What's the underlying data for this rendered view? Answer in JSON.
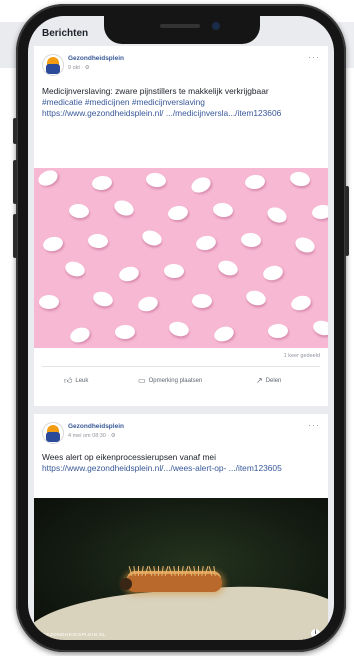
{
  "screen": {
    "title": "Berichten"
  },
  "posts": [
    {
      "page_name": "Gezondheidsplein",
      "meta": "9 okt · ⚙",
      "text": "Medicijnverslaving: zware pijnstillers te makkelijk verkrijgbaar",
      "hashtags": "#medicatie #medicijnen #medicijnverslaving",
      "link": "https://www.gezondheidsplein.nl/ .../medicijnversla.../item123606",
      "like_count": "1 keer gedeeld",
      "actions": {
        "like": "Leuk",
        "comment": "Opmerking plaatsen",
        "share": "Delen"
      }
    },
    {
      "page_name": "Gezondheidsplein",
      "meta": "4 mei om 08:30 · ⚙",
      "text": "Wees alert op eikenprocessierupsen vanaf mei",
      "link": "https://www.gezondheidsplein.nl/.../wees-alert-op- .../item123605",
      "source_label": "GEZONDHEIDSPLEIN.NL"
    }
  ],
  "icons": {
    "more": "ellipsis-icon",
    "like": "thumbs-up-icon",
    "comment": "comment-icon",
    "share": "share-icon",
    "info": "info-icon"
  },
  "colors": {
    "link": "#385898",
    "feed_bg": "#e9ebee",
    "pill_bg": "#f7b8d3"
  }
}
